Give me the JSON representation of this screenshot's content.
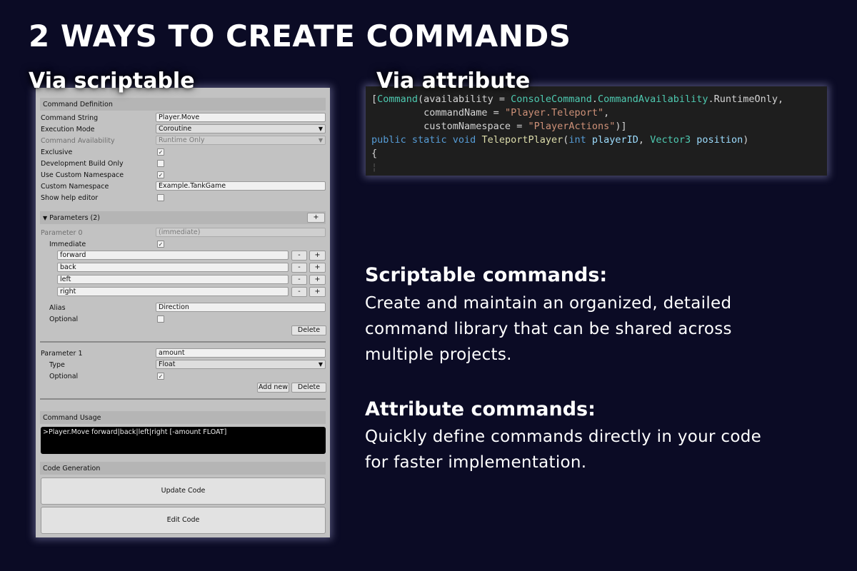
{
  "headline": "2 WAYS TO CREATE COMMANDS",
  "via_scriptable": "Via scriptable",
  "via_attribute": "Via attribute",
  "inspector": {
    "command_definition": "Command Definition",
    "fields": {
      "command_string_label": "Command String",
      "command_string_value": "Player.Move",
      "execution_mode_label": "Execution Mode",
      "execution_mode_value": "Coroutine",
      "command_availability_label": "Command Availability",
      "command_availability_value": "Runtime Only",
      "exclusive_label": "Exclusive",
      "development_build_label": "Development Build Only",
      "use_custom_namespace_label": "Use Custom Namespace",
      "custom_namespace_label": "Custom Namespace",
      "custom_namespace_value": "Example.TankGame",
      "show_help_label": "Show help editor"
    },
    "parameters_head": "Parameters (2)",
    "plus": "+",
    "minus": "-",
    "param0": {
      "label": "Parameter 0",
      "value": "(immediate)",
      "immediate_label": "Immediate",
      "options": [
        "forward",
        "back",
        "left",
        "right"
      ],
      "alias_label": "Alias",
      "alias_value": "Direction",
      "optional_label": "Optional",
      "delete_label": "Delete"
    },
    "param1": {
      "label": "Parameter 1",
      "value": "amount",
      "type_label": "Type",
      "type_value": "Float",
      "optional_label": "Optional",
      "add_new_label": "Add new",
      "delete_label": "Delete"
    },
    "command_usage_head": "Command Usage",
    "command_usage_text": ">Player.Move forward|back|left|right [-amount FLOAT]",
    "code_generation_head": "Code Generation",
    "update_code_label": "Update Code",
    "edit_code_label": "Edit Code",
    "check_mark": "✓",
    "dropdown_arrow": "▼",
    "foldout_arrow": "▼"
  },
  "code": {
    "l1_open": "[",
    "l1_command": "Command",
    "l1_a": "(availability = ",
    "l1_type": "ConsoleCommand",
    "l1_b": ".",
    "l1_enum": "CommandAvailability",
    "l1_c": ".RuntimeOnly,",
    "l2_a": "         commandName = ",
    "l2_str": "\"Player.Teleport\"",
    "l2_b": ",",
    "l3_a": "         customNamespace = ",
    "l3_str": "\"PlayerActions\"",
    "l3_b": ")]",
    "l4_kw": "public static void ",
    "l4_fn": "TeleportPlayer",
    "l4_a": "(",
    "l4_int": "int",
    "l4_p1": " playerID",
    "l4_b": ", ",
    "l4_v3": "Vector3",
    "l4_p2": " position",
    "l4_c": ")",
    "l5": "{",
    "guide_char": "¦"
  },
  "desc": {
    "scriptable_title": "Scriptable commands:",
    "scriptable_lines": [
      "Create and maintain an organized, detailed",
      "command library that can be shared across",
      "multiple projects."
    ],
    "attribute_title": "Attribute commands:",
    "attribute_lines": [
      "Quickly define commands directly in your code",
      "for faster implementation."
    ]
  }
}
